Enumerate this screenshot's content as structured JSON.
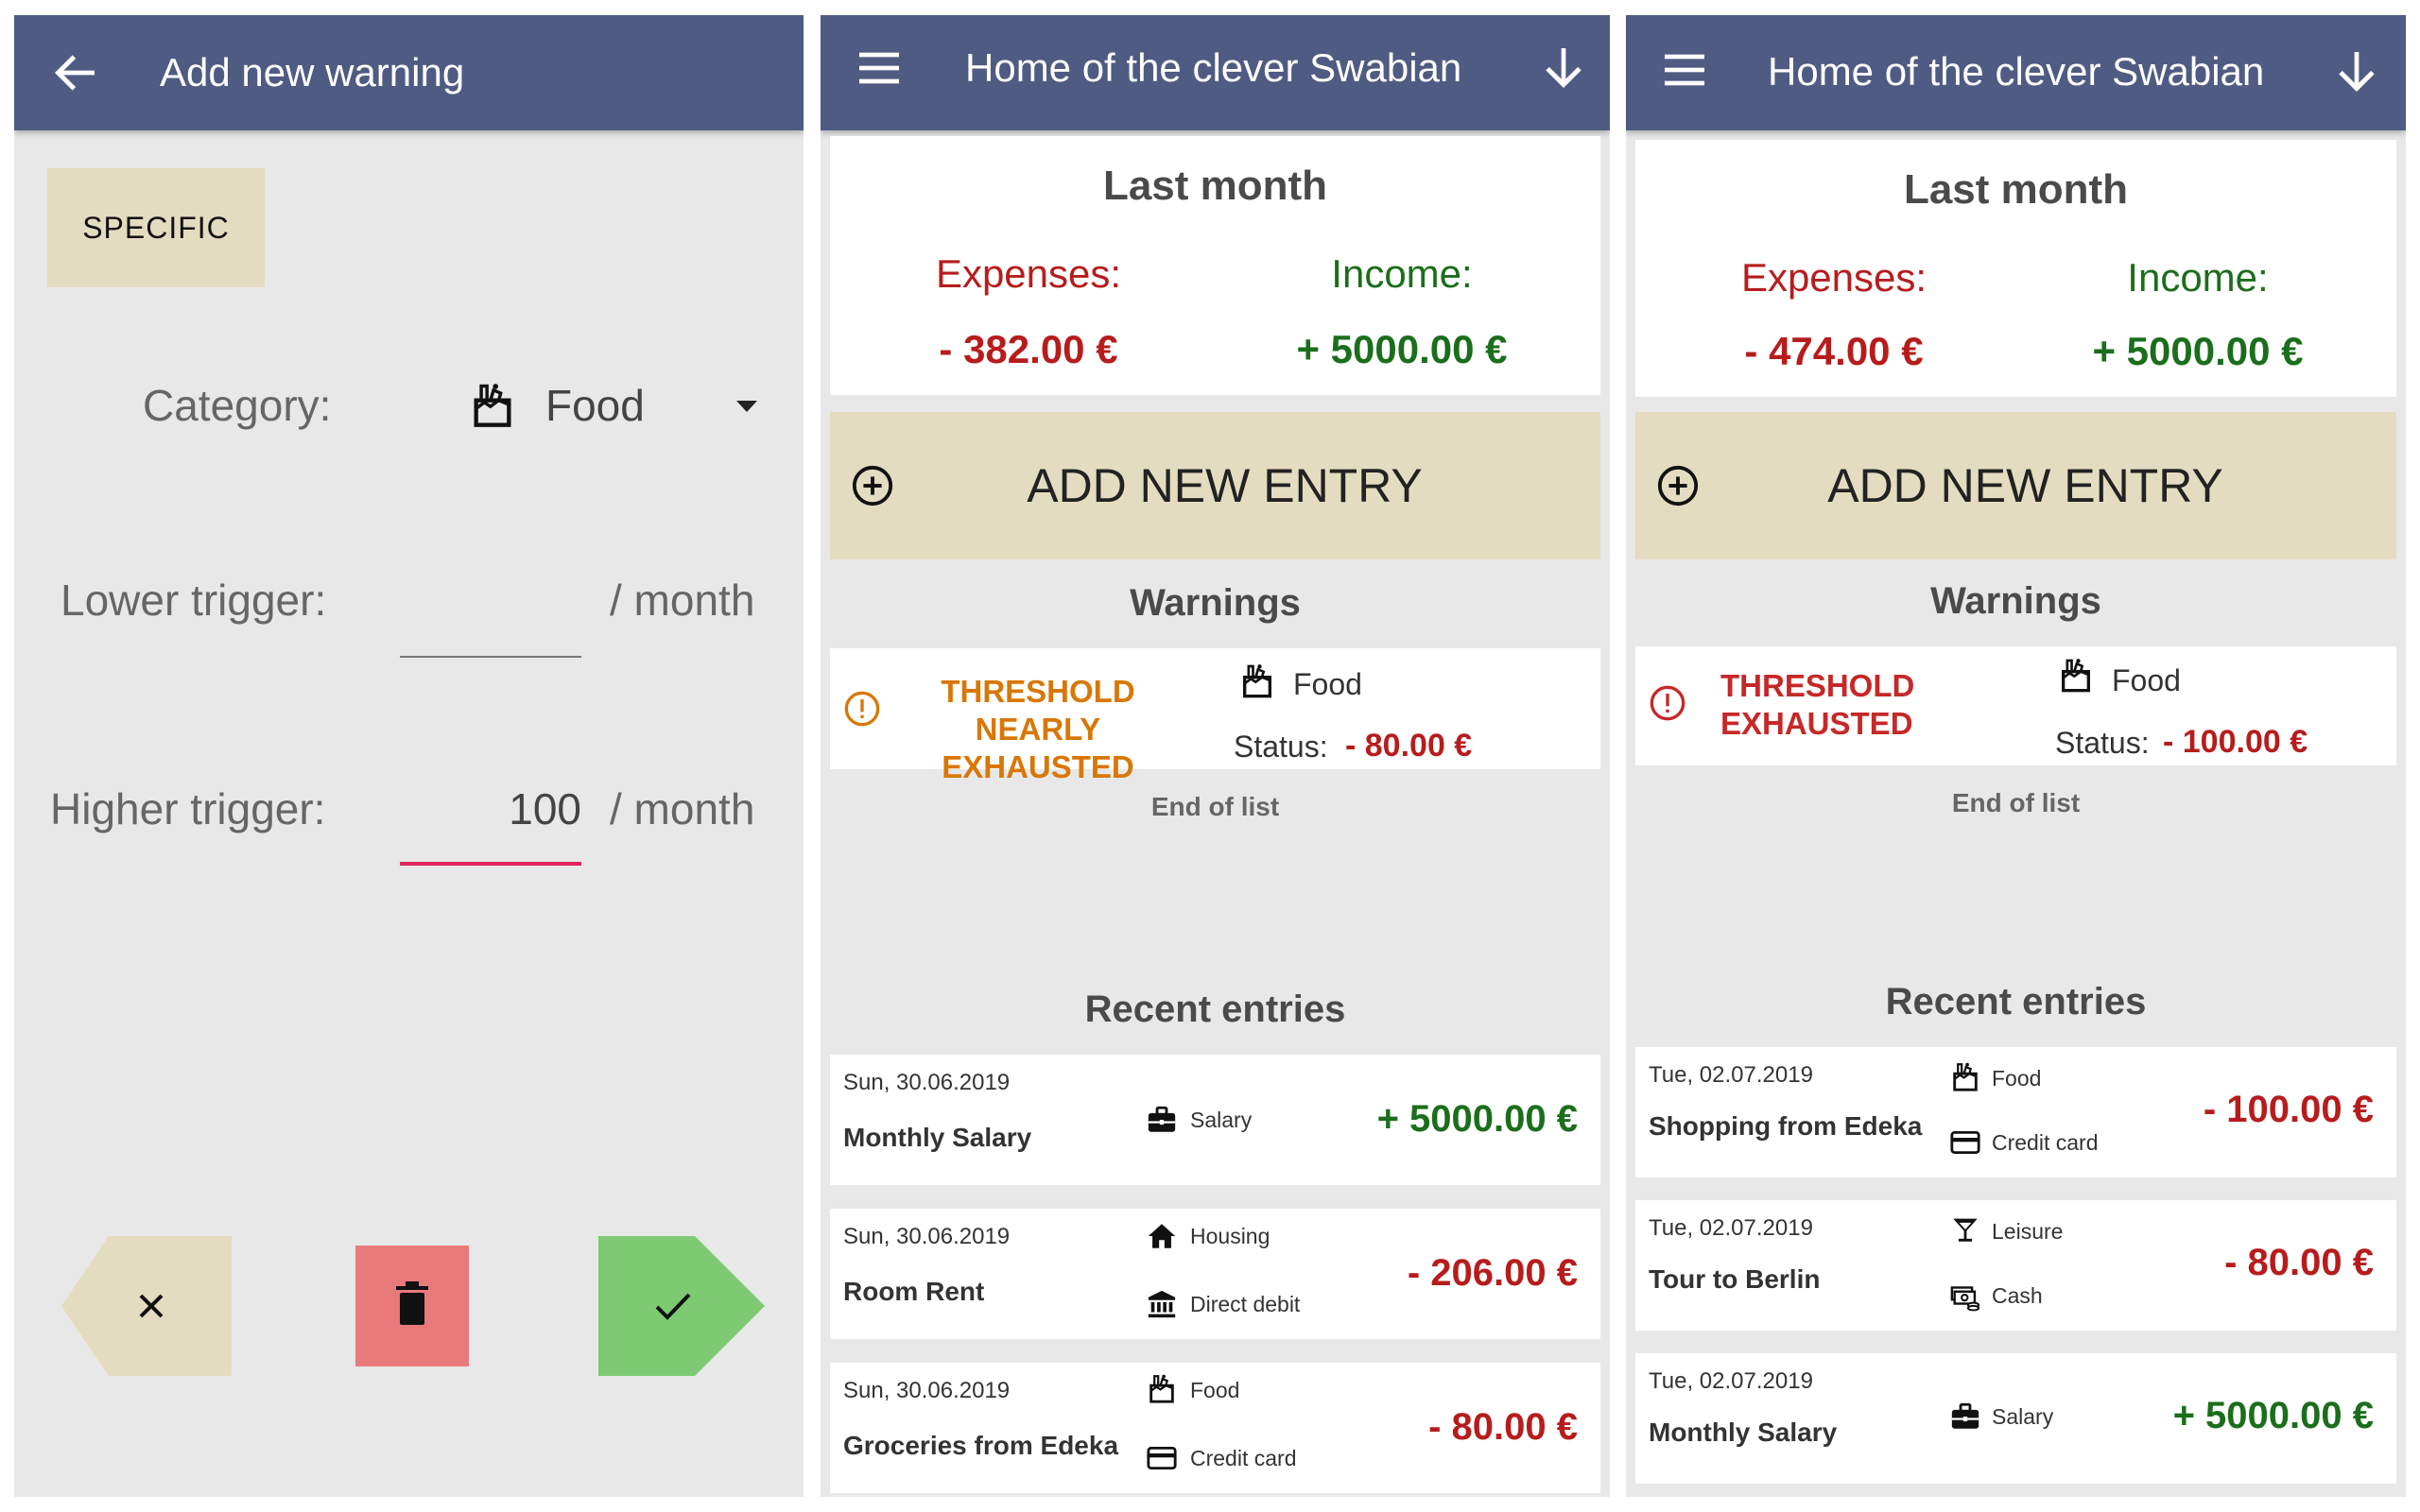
{
  "screen1": {
    "title": "Add new warning",
    "specific_label": "SPECIFIC",
    "category_label": "Category:",
    "category_value": "Food",
    "lower_label": "Lower trigger:",
    "lower_value": "",
    "lower_unit": "/ month",
    "higher_label": "Higher trigger:",
    "higher_value": "100",
    "higher_unit": "/ month",
    "colors": {
      "appbar": "#4f5b82",
      "specific": "#e4dcc0",
      "cancel": "#e4dcc0",
      "delete": "#e87a7c",
      "confirm": "#7dca73",
      "active_underline": "#e0245e"
    }
  },
  "screen2": {
    "title": "Home of the clever Swabian",
    "summary": {
      "title": "Last month",
      "expenses_label": "Expenses:",
      "expenses_value": "- 382.00 €",
      "income_label": "Income:",
      "income_value": "+ 5000.00 €"
    },
    "add_button": "ADD NEW ENTRY",
    "warnings_title": "Warnings",
    "warning": {
      "text_line1": "THRESHOLD NEARLY",
      "text_line2": "EXHAUSTED",
      "category": "Food",
      "status_label": "Status:",
      "status_value": "- 80.00 €",
      "color": "#d97706"
    },
    "end_of_list": "End of list",
    "recent_title": "Recent entries",
    "entries": [
      {
        "date": "Sun, 30.06.2019",
        "name": "Monthly Salary",
        "category": "Salary",
        "payment": "",
        "amount": "+ 5000.00 €"
      },
      {
        "date": "Sun, 30.06.2019",
        "name": "Room Rent",
        "category": "Housing",
        "payment": "Direct debit",
        "amount": "- 206.00 €"
      },
      {
        "date": "Sun, 30.06.2019",
        "name": "Groceries from Edeka",
        "category": "Food",
        "payment": "Credit card",
        "amount": "- 80.00 €"
      }
    ]
  },
  "screen3": {
    "title": "Home of the clever Swabian",
    "summary": {
      "title": "Last month",
      "expenses_label": "Expenses:",
      "expenses_value": "- 474.00 €",
      "income_label": "Income:",
      "income_value": "+ 5000.00 €"
    },
    "add_button": "ADD NEW ENTRY",
    "warnings_title": "Warnings",
    "warning": {
      "text_line1": "THRESHOLD",
      "text_line2": "EXHAUSTED",
      "category": "Food",
      "status_label": "Status:",
      "status_value": "- 100.00 €",
      "color": "#c62828"
    },
    "end_of_list": "End of list",
    "recent_title": "Recent entries",
    "entries": [
      {
        "date": "Tue, 02.07.2019",
        "name": "Shopping from Edeka",
        "category": "Food",
        "payment": "Credit card",
        "amount": "- 100.00 €"
      },
      {
        "date": "Tue, 02.07.2019",
        "name": "Tour to Berlin",
        "category": "Leisure",
        "payment": "Cash",
        "amount": "- 80.00 €"
      },
      {
        "date": "Tue, 02.07.2019",
        "name": "Monthly Salary",
        "category": "Salary",
        "payment": "",
        "amount": "+ 5000.00 €"
      }
    ]
  }
}
